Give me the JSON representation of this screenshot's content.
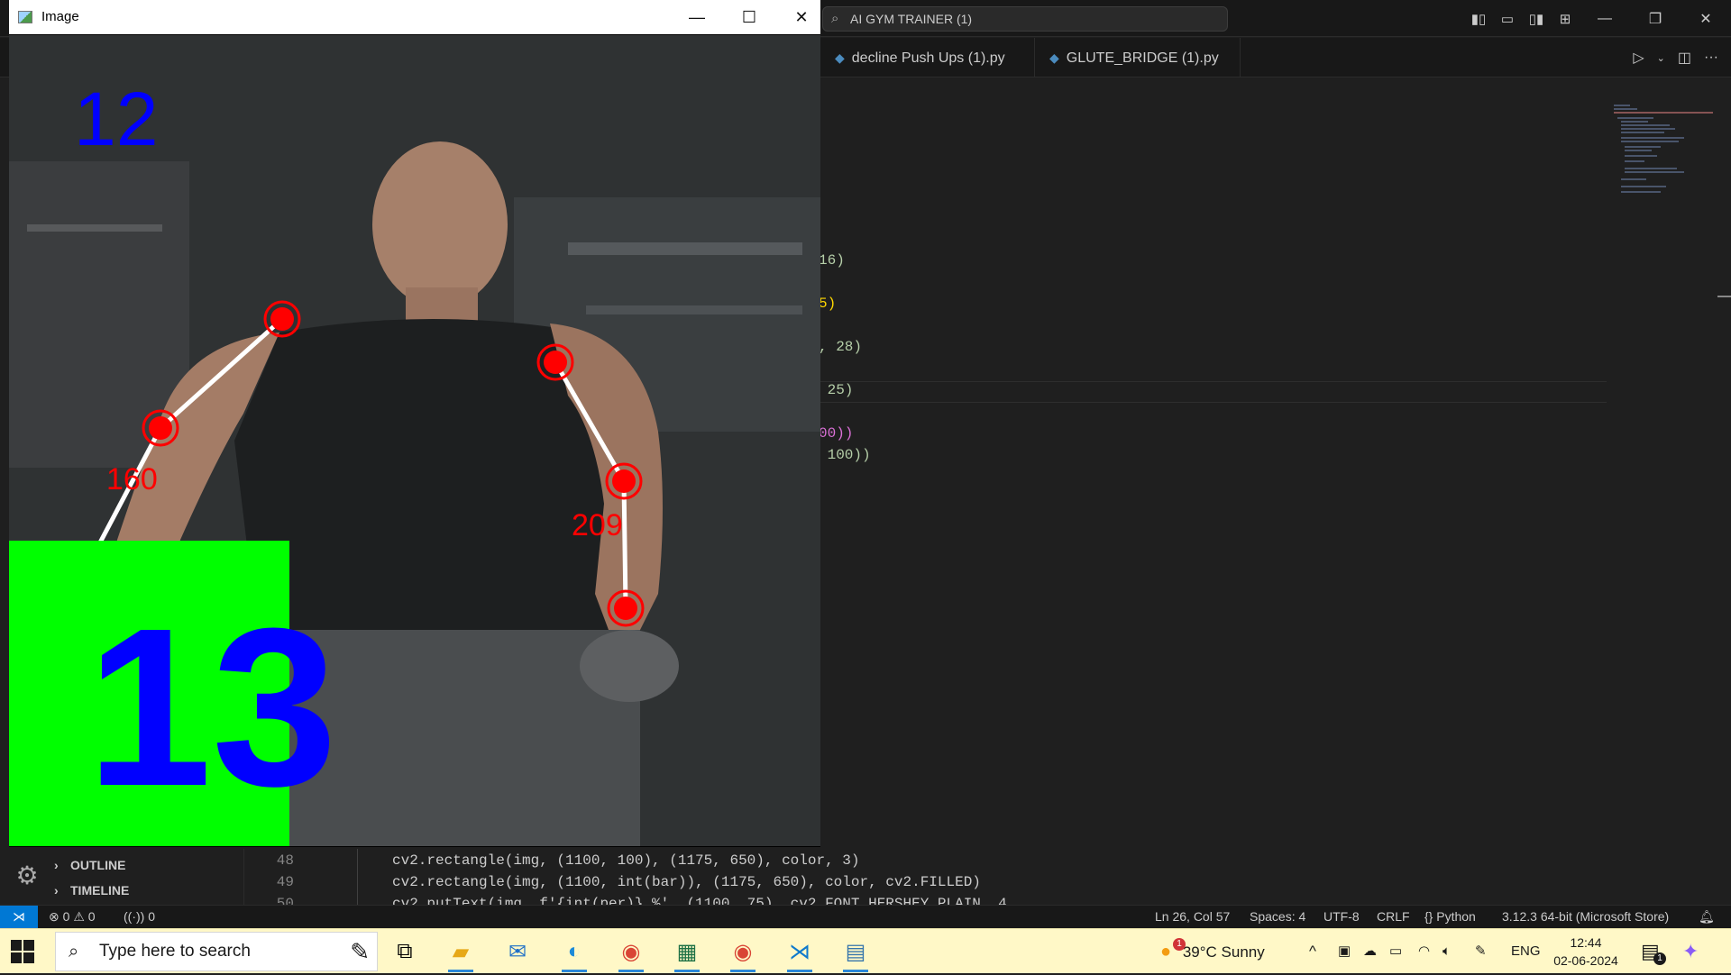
{
  "vscode": {
    "search_text": "AI GYM TRAINER (1)",
    "tabs": [
      {
        "label": "decline Push Ups (1).py"
      },
      {
        "label": "GLUTE_BRIDGE (1).py"
      }
    ],
    "code_fragments": [
      "16)",
      "5)",
      ", 28)",
      " 25)",
      "00))",
      " 100))"
    ],
    "bottom_panel": {
      "outline_label": "OUTLINE",
      "timeline_label": "TIMELINE",
      "line_numbers": [
        "48",
        "49",
        "50"
      ],
      "code_lines": [
        "cv2.rectangle(img, (1100, 100), (1175, 650), color, 3)",
        "cv2.rectangle(img, (1100, int(bar)), (1175, 650), color, cv2.FILLED)",
        "cv2.putText(img, f'{int(per)} %', (1100, 75), cv2.FONT_HERSHEY_PLAIN, 4,"
      ]
    },
    "status_bar": {
      "errors": "0",
      "warnings": "0",
      "ports": "0",
      "cursor": "Ln 26, Col 57",
      "spaces": "Spaces: 4",
      "encoding": "UTF-8",
      "eol": "CRLF",
      "language": "Python",
      "interpreter": "3.12.3 64-bit (Microsoft Store)"
    }
  },
  "image_window": {
    "title": "Image",
    "top_counter": "12",
    "rep_count": "13",
    "angle_left": "160",
    "angle_right": "209",
    "colors": {
      "counter": "#0000ff",
      "rep_box": "#00ff00",
      "joint": "#ff0000",
      "line": "#ffffff"
    }
  },
  "taskbar": {
    "search_placeholder": "Type here to search",
    "weather_badge": "1",
    "weather": "39°C  Sunny",
    "language": "ENG",
    "time": "12:44",
    "date": "02-06-2024",
    "notification_count": "1",
    "apps": [
      "task-view",
      "file-explorer",
      "mail",
      "edge",
      "chrome",
      "excel",
      "chrome-profile",
      "vscode",
      "python"
    ]
  }
}
